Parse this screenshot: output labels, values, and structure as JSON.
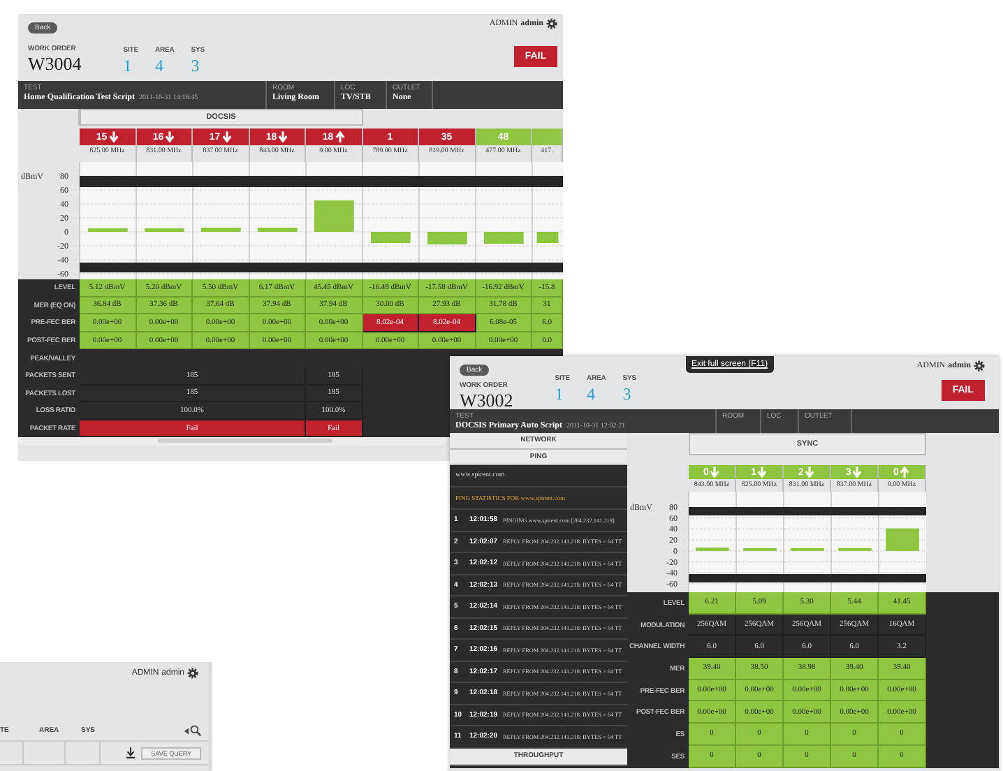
{
  "detail_w3004": {
    "back": "Back",
    "user": {
      "role": "ADMIN",
      "name": "admin"
    },
    "work_order": {
      "label": "WORK ORDER",
      "value": "W3004"
    },
    "fields": [
      {
        "label": "SITE",
        "value": "1"
      },
      {
        "label": "AREA",
        "value": "4"
      },
      {
        "label": "SYS",
        "value": "3"
      }
    ],
    "result": "FAIL",
    "info": [
      {
        "label": "TEST",
        "value": "Home Qualification Test Script",
        "time": "2011-10-31 14:16:45"
      },
      {
        "label": "ROOM",
        "value": "Living Room"
      },
      {
        "label": "LOC",
        "value": "TV/STB"
      },
      {
        "label": "OUTLET",
        "value": "None"
      }
    ],
    "group": "DOCSIS",
    "channels": [
      {
        "number": "15",
        "kind": "downstream",
        "failed": true,
        "frequency": "825.00 MHz"
      },
      {
        "number": "16",
        "kind": "downstream",
        "failed": true,
        "frequency": "831.00 MHz"
      },
      {
        "number": "17",
        "kind": "downstream",
        "failed": true,
        "frequency": "837.00 MHz"
      },
      {
        "number": "18",
        "kind": "downstream",
        "failed": true,
        "frequency": "843.00 MHz"
      },
      {
        "number": "18",
        "kind": "upstream",
        "failed": true,
        "frequency": "9.00 MHz"
      },
      {
        "number": "1",
        "kind": "plain",
        "failed": true,
        "frequency": "789.00 MHz"
      },
      {
        "number": "35",
        "kind": "plain",
        "failed": true,
        "frequency": "819.00 MHz"
      },
      {
        "number": "48",
        "kind": "plain",
        "failed": false,
        "frequency": "477.00 MHz"
      },
      {
        "kind": "plain",
        "failed": false,
        "frequency": "417."
      }
    ],
    "chart_data": {
      "type": "bar",
      "ylabel": "dBmV",
      "ylim": [
        -60,
        80
      ],
      "yticks": [
        80,
        60,
        40,
        20,
        0,
        -20,
        -40,
        -60
      ],
      "grid": true,
      "values": [
        5,
        5,
        6,
        6,
        45,
        -16,
        -18,
        -17,
        -16
      ]
    },
    "rows": [
      {
        "label": "LEVEL",
        "cells": [
          {
            "text": "5.12 dBmV",
            "kind": "pass"
          },
          {
            "text": "5.20 dBmV",
            "kind": "pass"
          },
          {
            "text": "5.50 dBmV",
            "kind": "pass"
          },
          {
            "text": "6.17 dBmV",
            "kind": "pass"
          },
          {
            "text": "45.45 dBmV",
            "kind": "pass"
          },
          {
            "text": "-16.49 dBmV",
            "kind": "pass"
          },
          {
            "text": "-17.58 dBmV",
            "kind": "pass"
          },
          {
            "text": "-16.92 dBmV",
            "kind": "pass"
          },
          {
            "text": "-15.8",
            "kind": "pass"
          }
        ]
      },
      {
        "label": "MER (EQ ON)",
        "cells": [
          {
            "text": "36.84 dB",
            "kind": "pass"
          },
          {
            "text": "37.36 dB",
            "kind": "pass"
          },
          {
            "text": "37.64 dB",
            "kind": "pass"
          },
          {
            "text": "37.94 dB",
            "kind": "pass"
          },
          {
            "text": "37.94 dB",
            "kind": "pass"
          },
          {
            "text": "30.00 dB",
            "kind": "pass"
          },
          {
            "text": "27.93 dB",
            "kind": "pass"
          },
          {
            "text": "31.78 dB",
            "kind": "pass"
          },
          {
            "text": "31",
            "kind": "pass"
          }
        ]
      },
      {
        "label": "PRE-FEC BER",
        "cells": [
          {
            "text": "0.00e+00",
            "kind": "pass"
          },
          {
            "text": "0.00e+00",
            "kind": "pass"
          },
          {
            "text": "0.00e+00",
            "kind": "pass"
          },
          {
            "text": "0.00e+00",
            "kind": "pass"
          },
          {
            "text": "0.00e+00",
            "kind": "pass"
          },
          {
            "text": "8.02e-04",
            "kind": "fail"
          },
          {
            "text": "8.02e-04",
            "kind": "fail"
          },
          {
            "text": "6.08e-05",
            "kind": "pass"
          },
          {
            "text": "6.0",
            "kind": "pass"
          }
        ]
      },
      {
        "label": "POST-FEC BER",
        "cells": [
          {
            "text": "0.00e+00",
            "kind": "pass"
          },
          {
            "text": "0.00e+00",
            "kind": "pass"
          },
          {
            "text": "0.00e+00",
            "kind": "pass"
          },
          {
            "text": "0.00e+00",
            "kind": "pass"
          },
          {
            "text": "0.00e+00",
            "kind": "pass"
          },
          {
            "text": "0.00e+00",
            "kind": "pass"
          },
          {
            "text": "0.00e+00",
            "kind": "pass"
          },
          {
            "text": "0.00e+00",
            "kind": "pass"
          },
          {
            "text": "0.0",
            "kind": "pass"
          }
        ]
      },
      {
        "label": "PEAK/VALLEY",
        "cells": []
      },
      {
        "label": "PACKETS SENT",
        "cells": [
          {
            "text": "185",
            "kind": "info",
            "merged": true
          },
          {
            "text": "185",
            "kind": "info"
          }
        ]
      },
      {
        "label": "PACKETS LOST",
        "cells": [
          {
            "text": "185",
            "kind": "info",
            "merged": true
          },
          {
            "text": "185",
            "kind": "info"
          }
        ]
      },
      {
        "label": "LOSS RATIO",
        "cells": [
          {
            "text": "100.0%",
            "kind": "info",
            "merged": true
          },
          {
            "text": "100.0%",
            "kind": "info"
          }
        ]
      },
      {
        "label": "PACKET RATE",
        "cells": [
          {
            "text": "Fail",
            "kind": "fail",
            "merged": true
          },
          {
            "text": "Fail",
            "kind": "fail"
          }
        ]
      }
    ]
  },
  "detail_w3002": {
    "fullscreen_hint": "Exit full screen (F11)",
    "back": "Back",
    "user": {
      "role": "ADMIN",
      "name": "admin"
    },
    "work_order": {
      "label": "WORK ORDER",
      "value": "W3002"
    },
    "fields": [
      {
        "label": "SITE",
        "value": "1"
      },
      {
        "label": "AREA",
        "value": "4"
      },
      {
        "label": "SYS",
        "value": "3"
      }
    ],
    "result": "FAIL",
    "info": [
      {
        "label": "TEST",
        "value": "DOCSIS Primary Auto Script",
        "time": "2011-10-31 12:02:21"
      },
      {
        "label": "ROOM"
      },
      {
        "label": "LOC"
      },
      {
        "label": "OUTLET"
      }
    ],
    "network": {
      "title": "NETWORK",
      "subtitle": "PING",
      "host": "www.spirent.com",
      "stats_title": "PING STATISTICS FOR www.spirent.com",
      "pings": [
        {
          "seq": "1",
          "time": "12:01:58",
          "message": "PINGING www.spirent.com [204.232.141.218]"
        },
        {
          "seq": "2",
          "time": "12:02:07",
          "message": "REPLY FROM 204.232.141.218: BYTES = 64 TT"
        },
        {
          "seq": "3",
          "time": "12:02:12",
          "message": "REPLY FROM 204.232.141.218: BYTES = 64 TT"
        },
        {
          "seq": "4",
          "time": "12:02:13",
          "message": "REPLY FROM 204.232.141.218: BYTES = 64 TT"
        },
        {
          "seq": "5",
          "time": "12:02:14",
          "message": "REPLY FROM 204.232.141.218: BYTES = 64 TT"
        },
        {
          "seq": "6",
          "time": "12:02:15",
          "message": "REPLY FROM 204.232.141.218: BYTES = 64 TT"
        },
        {
          "seq": "7",
          "time": "12:02:16",
          "message": "REPLY FROM 204.232.141.218: BYTES = 64 TT"
        },
        {
          "seq": "8",
          "time": "12:02:17",
          "message": "REPLY FROM 204.232.141.218: BYTES = 64 TT"
        },
        {
          "seq": "9",
          "time": "12:02:18",
          "message": "REPLY FROM 204.232.141.218: BYTES = 64 TT"
        },
        {
          "seq": "10",
          "time": "12:02:19",
          "message": "REPLY FROM 204.232.141.218: BYTES = 64 TT"
        },
        {
          "seq": "11",
          "time": "12:02:20",
          "message": "REPLY FROM 204.232.141.218: BYTES = 64 TT"
        }
      ],
      "sections": [
        "THROUGHPUT"
      ]
    },
    "group": "SYNC",
    "channels": [
      {
        "number": "0",
        "kind": "downstream",
        "failed": false,
        "frequency": "843.00 MHz"
      },
      {
        "number": "1",
        "kind": "downstream",
        "failed": false,
        "frequency": "825.00 MHz"
      },
      {
        "number": "2",
        "kind": "downstream",
        "failed": false,
        "frequency": "831.00 MHz"
      },
      {
        "number": "3",
        "kind": "downstream",
        "failed": false,
        "frequency": "837.00 MHz"
      },
      {
        "number": "0",
        "kind": "upstream",
        "failed": false,
        "frequency": "9.00 MHz"
      }
    ],
    "chart_data": {
      "type": "bar",
      "ylabel": "dBmV",
      "ylim": [
        -60,
        80
      ],
      "yticks": [
        80,
        60,
        40,
        20,
        0,
        -20,
        -40,
        -60
      ],
      "grid": true,
      "values": [
        6,
        5,
        5,
        5,
        41
      ]
    },
    "rows": [
      {
        "label": "LEVEL",
        "cells": [
          {
            "text": "6.21",
            "kind": "pass"
          },
          {
            "text": "5.09",
            "kind": "pass"
          },
          {
            "text": "5.30",
            "kind": "pass"
          },
          {
            "text": "5.44",
            "kind": "pass"
          },
          {
            "text": "41.45",
            "kind": "pass"
          }
        ]
      },
      {
        "label": "MODULATION",
        "cells": [
          {
            "text": "256QAM",
            "kind": "info"
          },
          {
            "text": "256QAM",
            "kind": "info"
          },
          {
            "text": "256QAM",
            "kind": "info"
          },
          {
            "text": "256QAM",
            "kind": "info"
          },
          {
            "text": "16QAM",
            "kind": "info"
          }
        ]
      },
      {
        "label": "CHANNEL WIDTH",
        "cells": [
          {
            "text": "6.0",
            "kind": "info"
          },
          {
            "text": "6.0",
            "kind": "info"
          },
          {
            "text": "6.0",
            "kind": "info"
          },
          {
            "text": "6.0",
            "kind": "info"
          },
          {
            "text": "3.2",
            "kind": "info"
          }
        ]
      },
      {
        "label": "MER",
        "cells": [
          {
            "text": "39.40",
            "kind": "pass"
          },
          {
            "text": "38.50",
            "kind": "pass"
          },
          {
            "text": "38.98",
            "kind": "pass"
          },
          {
            "text": "39.40",
            "kind": "pass"
          },
          {
            "text": "39.40",
            "kind": "pass"
          }
        ]
      },
      {
        "label": "PRE-FEC BER",
        "cells": [
          {
            "text": "0.00e+00",
            "kind": "pass"
          },
          {
            "text": "0.00e+00",
            "kind": "pass"
          },
          {
            "text": "0.00e+00",
            "kind": "pass"
          },
          {
            "text": "0.00e+00",
            "kind": "pass"
          },
          {
            "text": "0.00e+00",
            "kind": "pass"
          }
        ]
      },
      {
        "label": "POST-FEC BER",
        "cells": [
          {
            "text": "0.00e+00",
            "kind": "pass"
          },
          {
            "text": "0.00e+00",
            "kind": "pass"
          },
          {
            "text": "0.00e+00",
            "kind": "pass"
          },
          {
            "text": "0.00e+00",
            "kind": "pass"
          },
          {
            "text": "0.00e+00",
            "kind": "pass"
          }
        ]
      },
      {
        "label": "ES",
        "cells": [
          {
            "text": "0",
            "kind": "pass"
          },
          {
            "text": "0",
            "kind": "pass"
          },
          {
            "text": "0",
            "kind": "pass"
          },
          {
            "text": "0",
            "kind": "pass"
          },
          {
            "text": "0",
            "kind": "pass"
          }
        ]
      },
      {
        "label": "SES",
        "cells": [
          {
            "text": "0",
            "kind": "pass"
          },
          {
            "text": "0",
            "kind": "pass"
          },
          {
            "text": "0",
            "kind": "pass"
          },
          {
            "text": "0",
            "kind": "pass"
          },
          {
            "text": "0",
            "kind": "pass"
          }
        ]
      }
    ]
  },
  "query_window": {
    "user": {
      "role": "ADMIN",
      "name": "admin"
    },
    "columns": [
      "TE",
      "AREA",
      "SYS"
    ],
    "save_button": "SAVE QUERY"
  }
}
